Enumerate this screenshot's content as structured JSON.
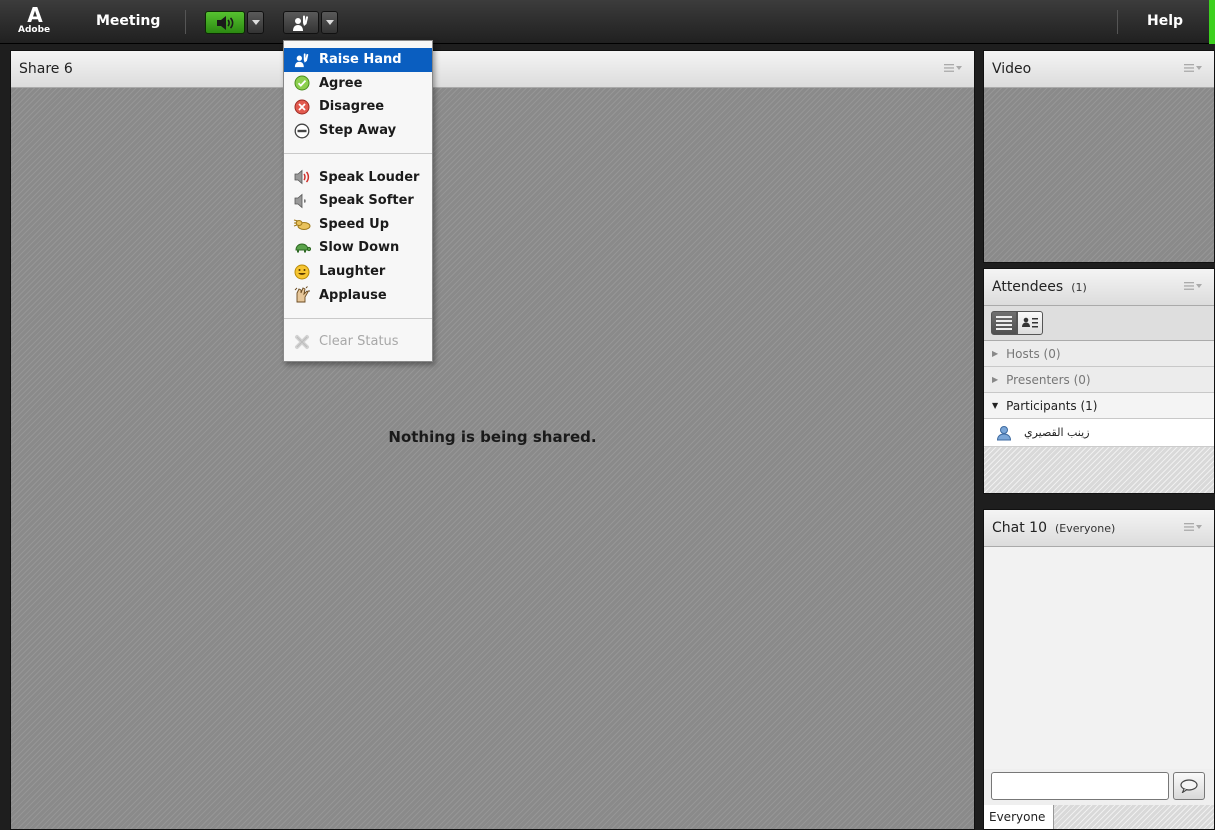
{
  "topbar": {
    "logo_mark": "A",
    "logo_text": "Adobe",
    "meeting_menu": "Meeting",
    "help_menu": "Help"
  },
  "status_menu": {
    "items": [
      {
        "label": "Raise Hand",
        "icon": "raise-hand-icon",
        "selected": true
      },
      {
        "label": "Agree",
        "icon": "agree-check-icon"
      },
      {
        "label": "Disagree",
        "icon": "disagree-x-icon"
      },
      {
        "label": "Step Away",
        "icon": "step-away-icon"
      },
      {
        "label": "Speak Louder",
        "icon": "speak-louder-icon"
      },
      {
        "label": "Speak Softer",
        "icon": "speak-softer-icon"
      },
      {
        "label": "Speed Up",
        "icon": "speed-up-icon"
      },
      {
        "label": "Slow Down",
        "icon": "slow-down-icon"
      },
      {
        "label": "Laughter",
        "icon": "laughter-icon"
      },
      {
        "label": "Applause",
        "icon": "applause-icon"
      },
      {
        "label": "Clear Status",
        "icon": "clear-status-icon",
        "disabled": true
      }
    ]
  },
  "share_pod": {
    "title": "Share 6",
    "empty_message": "Nothing is being shared."
  },
  "video_pod": {
    "title": "Video"
  },
  "attendees_pod": {
    "title": "Attendees",
    "count": "(1)",
    "groups": [
      {
        "label": "Hosts (0)"
      },
      {
        "label": "Presenters (0)"
      },
      {
        "label": "Participants (1)"
      }
    ],
    "participant_name": "زينب القصيري"
  },
  "chat_pod": {
    "title": "Chat 10",
    "audience": "(Everyone)",
    "input_value": "",
    "tab_everyone": "Everyone"
  },
  "colors": {
    "accent_selected": "#0a5ec0",
    "audio_on": "#3cb81f",
    "connection": "#3cd11e"
  }
}
